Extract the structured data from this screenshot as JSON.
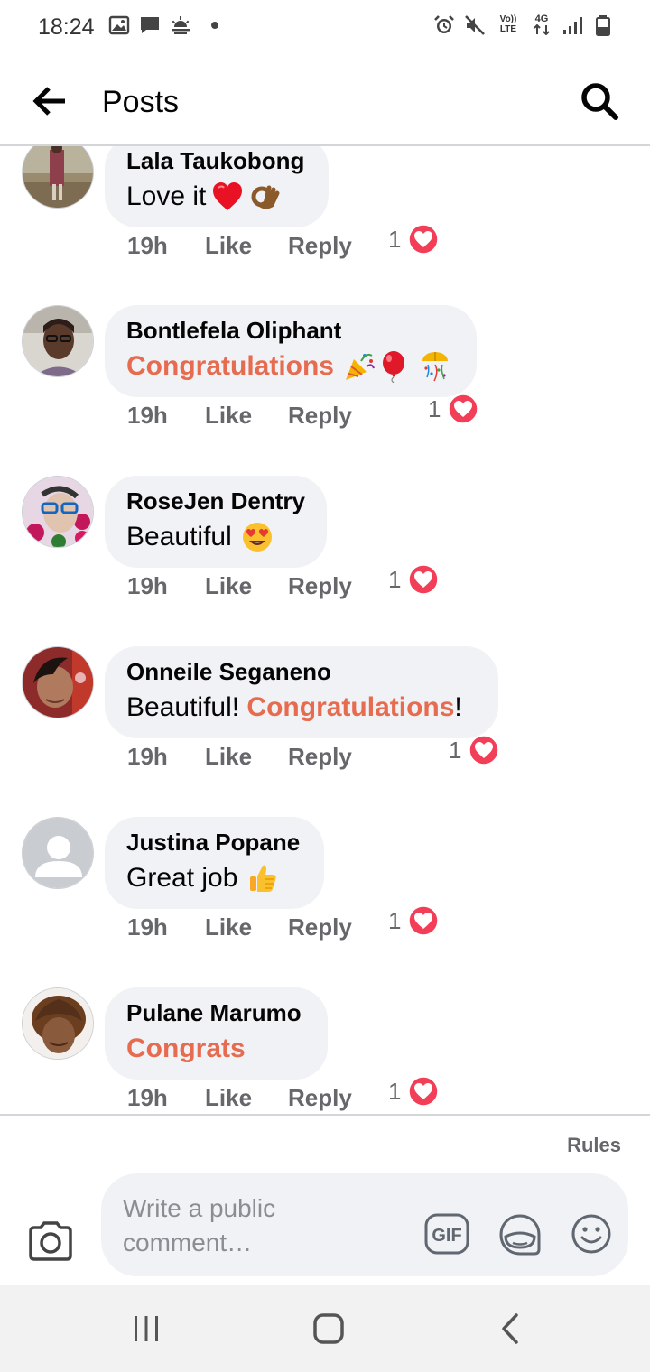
{
  "status_bar": {
    "time": "18:24",
    "left_icons": [
      "image-icon",
      "message-icon",
      "weather-icon"
    ],
    "right_icons": [
      "alarm-icon",
      "mute-icon",
      "volte-icon",
      "4g-icon",
      "signal-icon",
      "battery-icon"
    ],
    "volte_label": "Vo)) LTE",
    "network_label": "4G"
  },
  "header": {
    "title": "Posts"
  },
  "comments": [
    {
      "author": "Lala Taukobong",
      "text_parts": [
        {
          "text": "Love it",
          "highlight": false
        }
      ],
      "emojis": [
        "red-heart-emoji",
        "ok-hand-emoji"
      ],
      "time": "19h",
      "like": "Like",
      "reply": "Reply",
      "reaction_count": "1"
    },
    {
      "author": "Bontlefela Oliphant",
      "text_parts": [
        {
          "text": "Congratulations",
          "highlight": true
        }
      ],
      "emojis": [
        "party-popper-emoji",
        "balloon-emoji",
        "confetti-ball-emoji"
      ],
      "time": "19h",
      "like": "Like",
      "reply": "Reply",
      "reaction_count": "1"
    },
    {
      "author": "RoseJen Dentry",
      "text_parts": [
        {
          "text": "Beautiful",
          "highlight": false
        }
      ],
      "emojis": [
        "heart-eyes-emoji"
      ],
      "time": "19h",
      "like": "Like",
      "reply": "Reply",
      "reaction_count": "1"
    },
    {
      "author": "Onneile Seganeno",
      "text_parts": [
        {
          "text": "Beautiful! ",
          "highlight": false
        },
        {
          "text": "Congratulations",
          "highlight": true
        },
        {
          "text": "!",
          "highlight": false
        }
      ],
      "emojis": [],
      "time": "19h",
      "like": "Like",
      "reply": "Reply",
      "reaction_count": "1"
    },
    {
      "author": "Justina Popane",
      "text_parts": [
        {
          "text": "Great job",
          "highlight": false
        }
      ],
      "emojis": [
        "thumbs-up-emoji"
      ],
      "time": "19h",
      "like": "Like",
      "reply": "Reply",
      "reaction_count": "1"
    },
    {
      "author": "Pulane Marumo",
      "text_parts": [
        {
          "text": "Congrats",
          "highlight": true
        }
      ],
      "emojis": [],
      "time": "19h",
      "like": "Like",
      "reply": "Reply",
      "reaction_count": "1"
    }
  ],
  "footer": {
    "rules": "Rules",
    "placeholder": "Write a public comment…",
    "gif_label": "GIF"
  },
  "colors": {
    "highlight": "#e66b4f",
    "bubble": "#f0f2f5",
    "secondary_text": "#65676b",
    "heart": "#f33e58"
  }
}
